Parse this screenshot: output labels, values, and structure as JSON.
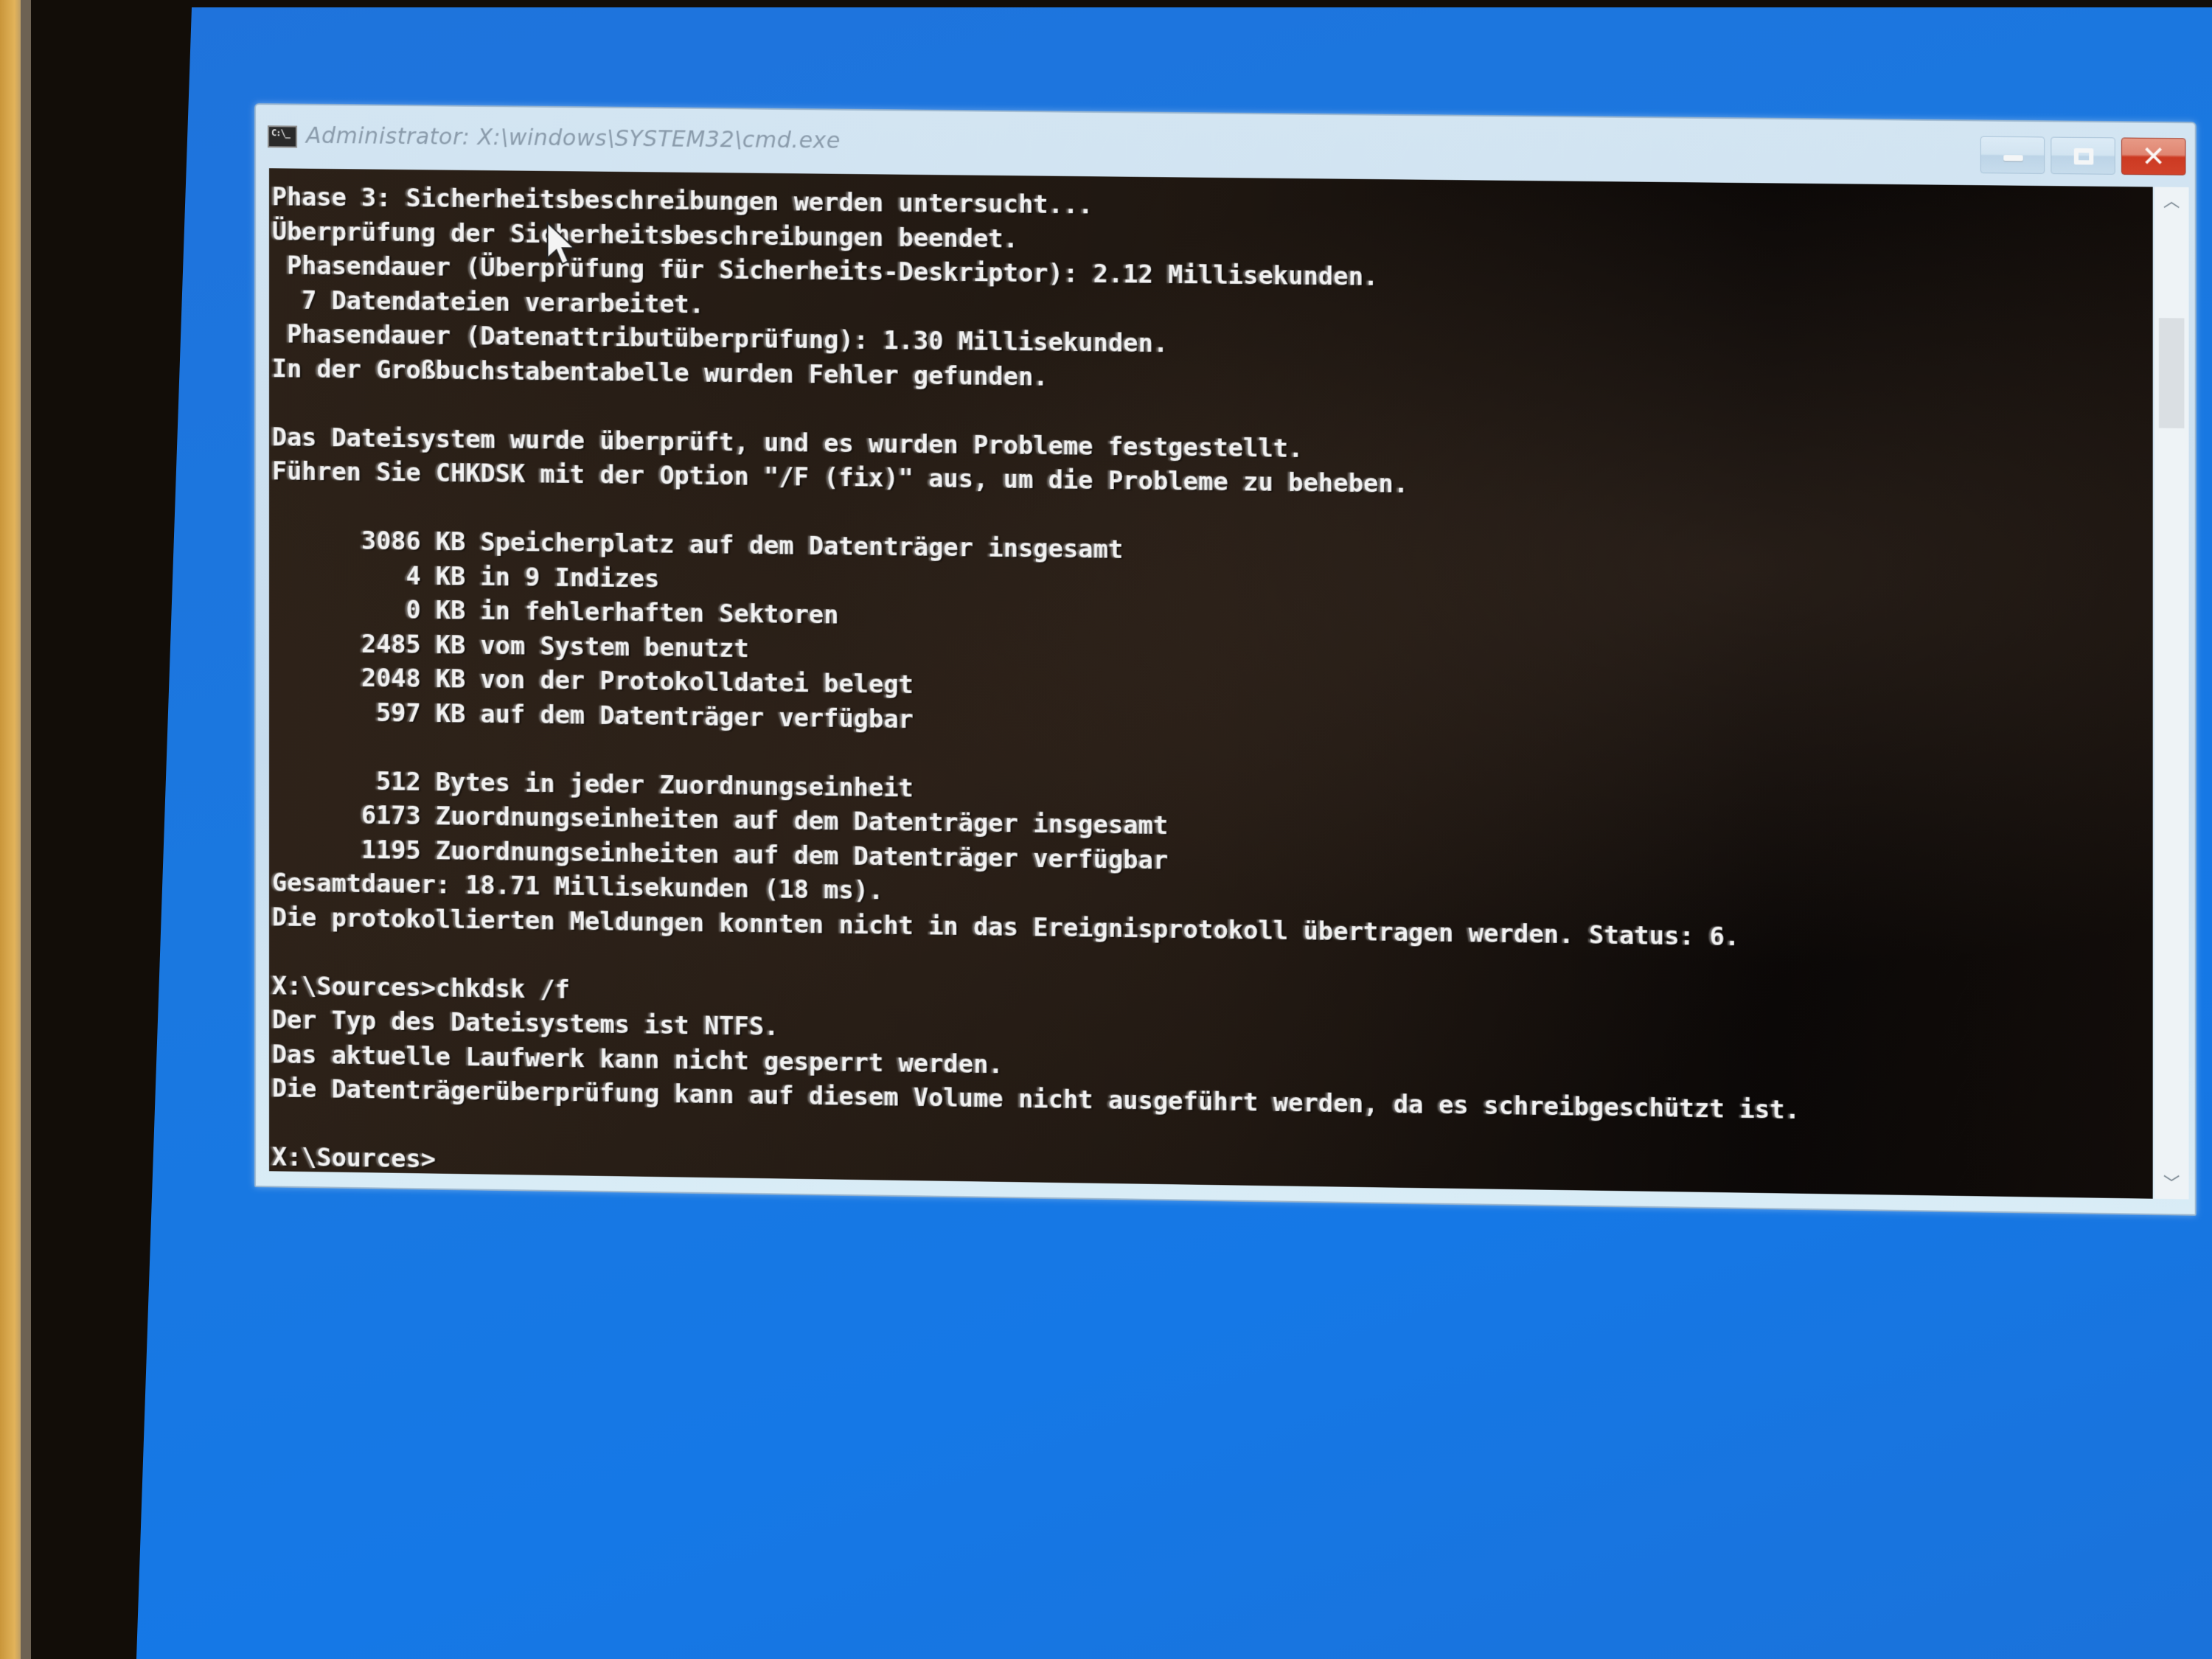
{
  "window": {
    "title": "Administrator: X:\\windows\\SYSTEM32\\cmd.exe",
    "icon": "cmd-console-icon",
    "controls": {
      "minimize": "minimize",
      "maximize": "maximize",
      "close": "✕"
    }
  },
  "console": {
    "lines": [
      "Phase 3: Sicherheitsbeschreibungen werden untersucht...",
      "Überprüfung der Sicherheitsbeschreibungen beendet.",
      " Phasendauer (Überprüfung für Sicherheits-Deskriptor): 2.12 Millisekunden.",
      "  7 Datendateien verarbeitet.",
      " Phasendauer (Datenattributüberprüfung): 1.30 Millisekunden.",
      "In der Großbuchstabentabelle wurden Fehler gefunden.",
      "",
      "Das Dateisystem wurde überprüft, und es wurden Probleme festgestellt.",
      "Führen Sie CHKDSK mit der Option \"/F (fix)\" aus, um die Probleme zu beheben.",
      "",
      "      3086 KB Speicherplatz auf dem Datenträger insgesamt",
      "         4 KB in 9 Indizes",
      "         0 KB in fehlerhaften Sektoren",
      "      2485 KB vom System benutzt",
      "      2048 KB von der Protokolldatei belegt",
      "       597 KB auf dem Datenträger verfügbar",
      "",
      "       512 Bytes in jeder Zuordnungseinheit",
      "      6173 Zuordnungseinheiten auf dem Datenträger insgesamt",
      "      1195 Zuordnungseinheiten auf dem Datenträger verfügbar",
      "Gesamtdauer: 18.71 Millisekunden (18 ms).",
      "Die protokollierten Meldungen konnten nicht in das Ereignisprotokoll übertragen werden. Status: 6.",
      "",
      "X:\\Sources>chkdsk /f",
      "Der Typ des Dateisystems ist NTFS.",
      "Das aktuelle Laufwerk kann nicht gesperrt werden.",
      "Die Datenträgerüberprüfung kann auf diesem Volume nicht ausgeführt werden, da es schreibgeschützt ist.",
      "",
      "X:\\Sources>"
    ],
    "prompt": "X:\\Sources>",
    "last_command": "chkdsk /f"
  },
  "scrollbar": {
    "up_arrow": "︿",
    "down_arrow": "﹀",
    "position_fraction": 0.12
  },
  "colors": {
    "desktop_background": "#1a78e0",
    "console_background": "#1f1711",
    "console_text": "#f2f2f2",
    "close_button": "#d2432b"
  }
}
